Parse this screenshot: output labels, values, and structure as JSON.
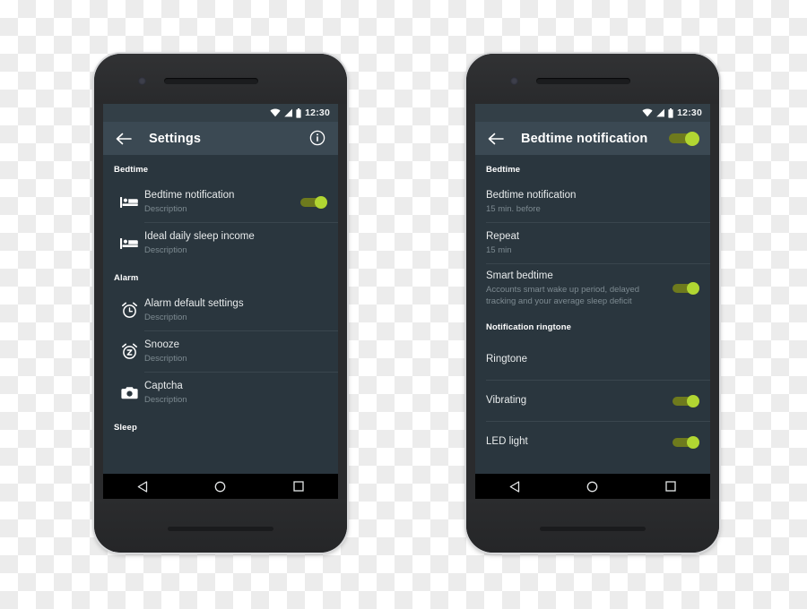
{
  "meta": {
    "scene": "Two Android phone mockups showing app settings screens"
  },
  "statusbar": {
    "time": "12:30",
    "icons": [
      "wifi-icon",
      "signal-icon",
      "battery-icon"
    ]
  },
  "navbar": {
    "back": "back-triangle-icon",
    "home": "home-circle-icon",
    "recents": "recents-square-icon"
  },
  "phone_left": {
    "appbar": {
      "back_icon": "arrow-left-icon",
      "title": "Settings",
      "info_icon": "info-circle-icon"
    },
    "sections": [
      {
        "header": "Bedtime",
        "items": [
          {
            "icon": "bed-icon",
            "title": "Bedtime notification",
            "subtitle": "Description",
            "toggle": true,
            "toggle_on": true
          },
          {
            "icon": "bed-icon",
            "title": "Ideal daily sleep income",
            "subtitle": "Description",
            "toggle": false
          }
        ]
      },
      {
        "header": "Alarm",
        "items": [
          {
            "icon": "alarm-clock-icon",
            "title": "Alarm default settings",
            "subtitle": "Description",
            "toggle": false
          },
          {
            "icon": "snooze-icon",
            "title": "Snooze",
            "subtitle": "Description",
            "toggle": false
          },
          {
            "icon": "camera-icon",
            "title": "Captcha",
            "subtitle": "Description",
            "toggle": false
          }
        ]
      },
      {
        "header": "Sleep",
        "items": []
      }
    ]
  },
  "phone_right": {
    "appbar": {
      "back_icon": "arrow-left-icon",
      "title": "Bedtime notification",
      "toggle_on": true
    },
    "sections": [
      {
        "header": "Bedtime",
        "items": [
          {
            "title": "Bedtime notification",
            "subtitle": "15 min. before",
            "toggle": false
          },
          {
            "title": "Repeat",
            "subtitle": "15 min",
            "toggle": false
          },
          {
            "title": "Smart bedtime",
            "subtitle": "Accounts smart wake up period, delayed tracking and your average sleep deficit",
            "toggle": true,
            "toggle_on": true
          }
        ]
      },
      {
        "header": "Notification ringtone",
        "items": [
          {
            "title": "Ringtone",
            "subtitle": "",
            "toggle": false
          },
          {
            "title": "Vibrating",
            "subtitle": "",
            "toggle": true,
            "toggle_on": true
          },
          {
            "title": "LED light",
            "subtitle": "",
            "toggle": true,
            "toggle_on": true
          }
        ]
      }
    ]
  },
  "colors": {
    "accent_thumb": "#b1d632",
    "accent_track": "#6e7a1d",
    "appbar_bg": "#3b4953",
    "list_bg": "#2a363e",
    "statusbar_bg": "#333f47",
    "navbar_bg": "#000000",
    "title_text": "#ffffff",
    "subtitle_text": "#7d8a91"
  }
}
